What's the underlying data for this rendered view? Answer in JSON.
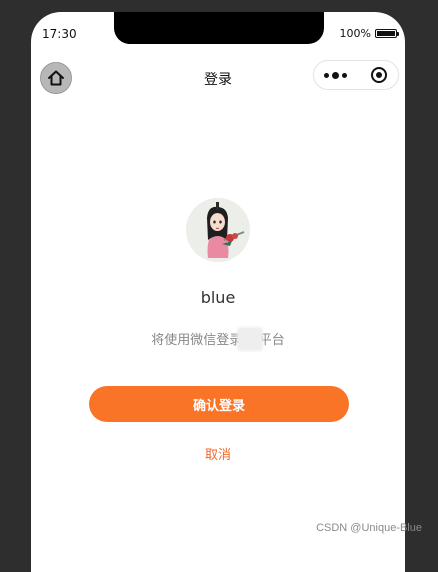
{
  "status_bar": {
    "time": "17:30",
    "battery": "100%"
  },
  "nav": {
    "title": "登录",
    "home_icon": "home-icon",
    "more_icon": "more-dots-icon",
    "close_icon": "mini-program-close-icon"
  },
  "user": {
    "name": "blue"
  },
  "login_note": "将使用微信登录    平台",
  "actions": {
    "confirm": "确认登录",
    "cancel": "取消"
  },
  "watermark": "CSDN @Unique-Blue",
  "colors": {
    "primary": "#fa7427",
    "cancel_text": "#f06a24"
  }
}
